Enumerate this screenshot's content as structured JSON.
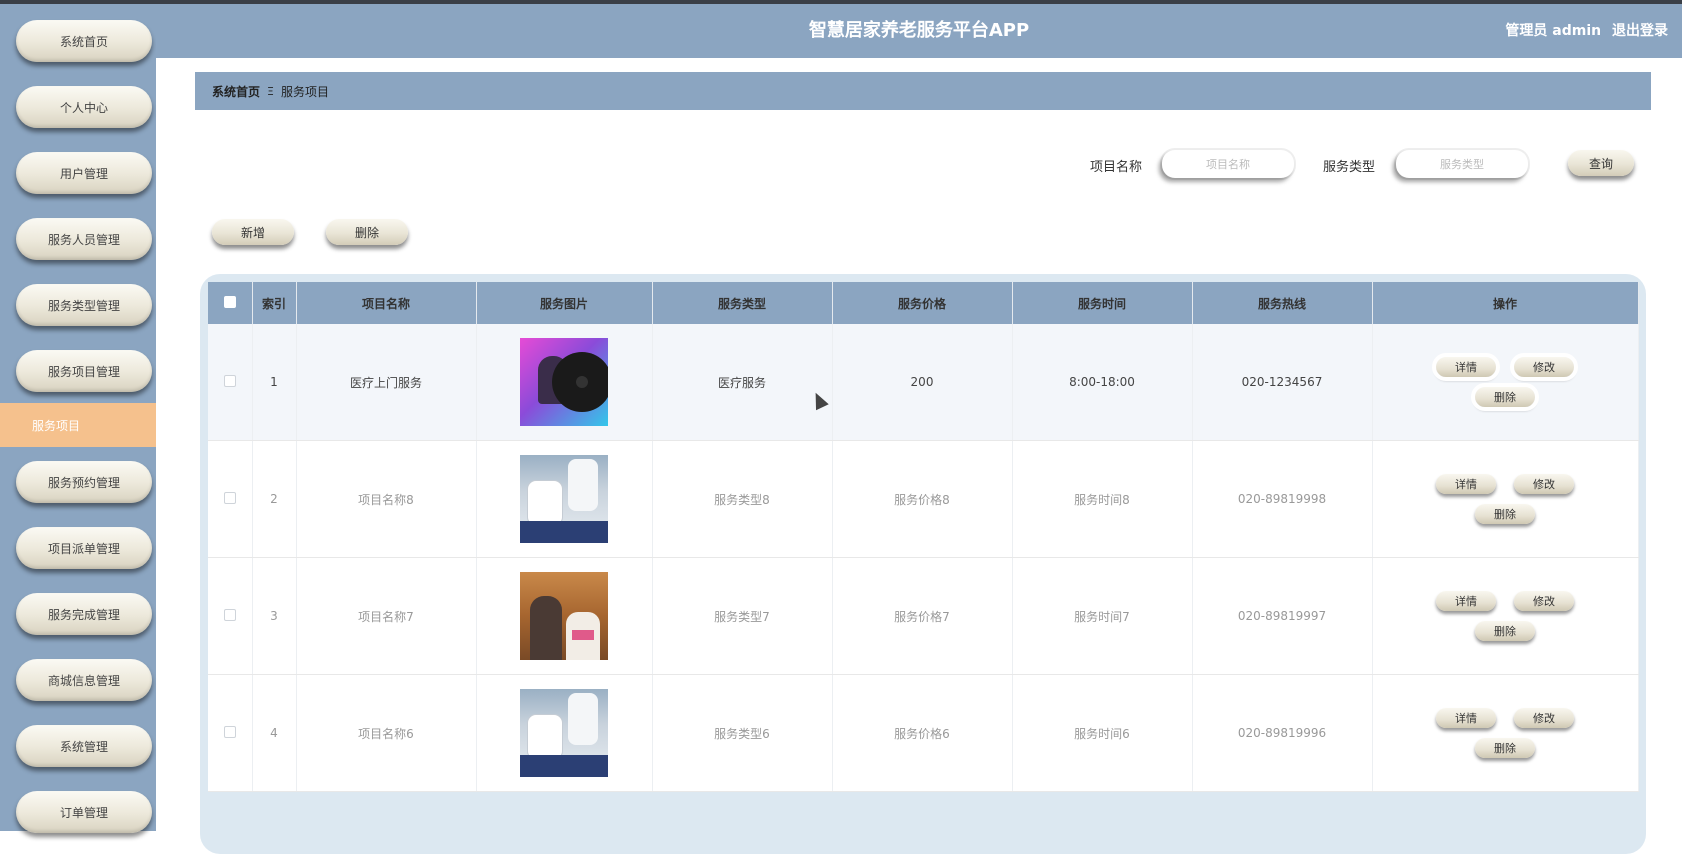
{
  "header": {
    "title": "智慧居家养老服务平台APP",
    "user_label": "管理员 admin",
    "logout": "退出登录"
  },
  "sidebar": {
    "items": [
      {
        "label": "系统首页"
      },
      {
        "label": "个人中心"
      },
      {
        "label": "用户管理"
      },
      {
        "label": "服务人员管理"
      },
      {
        "label": "服务类型管理"
      },
      {
        "label": "服务项目管理"
      },
      {
        "label": "服务预约管理"
      },
      {
        "label": "项目派单管理"
      },
      {
        "label": "服务完成管理"
      },
      {
        "label": "商城信息管理"
      },
      {
        "label": "系统管理"
      },
      {
        "label": "订单管理"
      }
    ],
    "active_sub": "服务项目"
  },
  "breadcrumb": {
    "home": "系统首页",
    "separator": "Ξ",
    "current": "服务项目"
  },
  "search": {
    "name_label": "项目名称",
    "name_placeholder": "项目名称",
    "type_label": "服务类型",
    "type_placeholder": "服务类型",
    "query": "查询"
  },
  "toolbar": {
    "add": "新增",
    "delete": "删除"
  },
  "table": {
    "columns": [
      "索引",
      "项目名称",
      "服务图片",
      "服务类型",
      "服务价格",
      "服务时间",
      "服务热线",
      "操作"
    ],
    "rows": [
      {
        "index": "1",
        "name": "医疗上门服务",
        "image": "album-cover-image",
        "type": "医疗服务",
        "price": "200",
        "time": "8:00-18:00",
        "hotline": "020-1234567"
      },
      {
        "index": "2",
        "name": "项目名称8",
        "image": "nurse-care-image",
        "type": "服务类型8",
        "price": "服务价格8",
        "time": "服务时间8",
        "hotline": "020-89819998"
      },
      {
        "index": "3",
        "name": "项目名称7",
        "image": "elderly-care-image",
        "type": "服务类型7",
        "price": "服务价格7",
        "time": "服务时间7",
        "hotline": "020-89819997"
      },
      {
        "index": "4",
        "name": "项目名称6",
        "image": "nurse-care-image",
        "type": "服务类型6",
        "price": "服务价格6",
        "time": "服务时间6",
        "hotline": "020-89819996"
      }
    ],
    "actions": {
      "detail": "详情",
      "edit": "修改",
      "delete": "删除"
    }
  },
  "colors": {
    "primary": "#8ba5c1",
    "active": "#f5c18d",
    "frame": "#dce8f1"
  }
}
